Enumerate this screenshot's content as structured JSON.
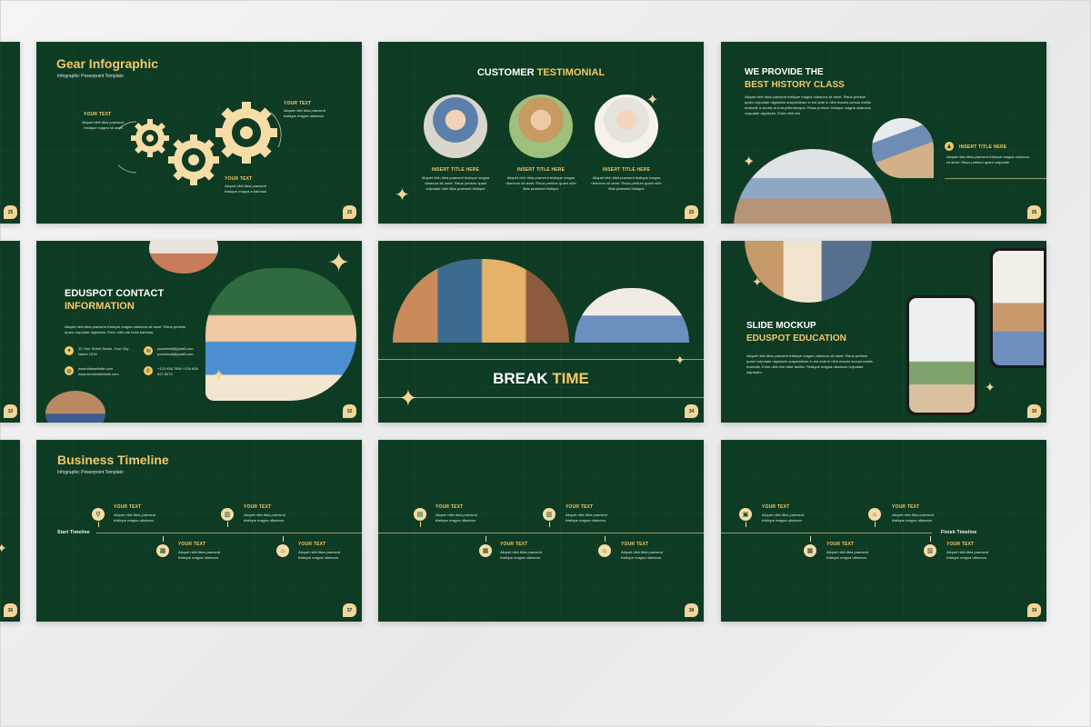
{
  "colors": {
    "slide_bg": "#0e3b23",
    "accent": "#f3c96b",
    "cream": "#f6dca6",
    "page_bg": "#eeeeee"
  },
  "gear": {
    "title": "Gear Infographic",
    "subtitle": "Infographic Powerpoint Template",
    "text_left_label": "YOUR TEXT",
    "text_left_body": "Aliquet nibh tibia praesent tristique magna sit amet.",
    "text_top_label": "YOUR TEXT",
    "text_top_body": "Aliquet nibh tibia praesent tristique magna ullamcos",
    "text_bottom_label": "YOUR TEXT",
    "text_bottom_body": "Aliquet nibh tibia praesent tristique magna a batrinas",
    "page": "25"
  },
  "testimonial": {
    "title_a": "CUSTOMER",
    "title_b": "TESTIMONIAL",
    "items": [
      {
        "label": "INSERT TITLE HERE",
        "body": "Aliquet nibh tibia praesent tristique magna ullamcos sit amet. Risus pretium quam vulputate nibh tibia praesent tristique"
      },
      {
        "label": "INSERT TITLE HERE",
        "body": "Aliquet nibh tibia praesent tristique magna ullamcos sit amet. Risus pretium quam nibh tibia praesent tristique"
      },
      {
        "label": "INSERT TITLE HERE",
        "body": "Aliquet nibh tibia praesent tristique magna ullamcos sit amet. Risus pretium quam nibh tibia praesent tristique"
      }
    ],
    "page": "25"
  },
  "history": {
    "title_a": "WE PROVIDE THE",
    "title_b": "BEST HISTORY CLASS",
    "body": "Aliquet nibh tibia praesent tristique magna ullamcos sit amet. Risus pretium quam vulputate dignissim suspendisse in est ante in nibh mauris cursus mattis molestie a iaculis at erat pellentesque. Risus pretium tristique magna ullamcos vulputate dignissim. Enim nibh nisl",
    "insert_label": "INSERT TITLE HERE",
    "insert_body": "Aliquet nibh tibia praesent tristique magna ullamcos sit amet. Risus pretium quam vulputate",
    "page": "26"
  },
  "contact": {
    "title_a": "EDUSPOT CONTACT",
    "title_b": "INFORMATION",
    "body": "Aliquet nibh tibia praesent tristique magna ullamcos sit amet. Risus pretium quam vulputate dignissim. Enim nibh nisl tenis batrinas.",
    "address": "12 Your Street Name, Your City Name 1234",
    "email": "youremail@gmail.com youremail@gmail.com",
    "website": "www.thiswebsite.com www.secondwebsite.com",
    "phone": "+123 456 7890 +234 608 827 8270",
    "page": "32"
  },
  "breaktime": {
    "title_a": "BREAK",
    "title_b": "TIME",
    "page": "34"
  },
  "mockup": {
    "title_a": "SLIDE MOCKUP",
    "title_b": "EDUSPOT EDUCATION",
    "body": "Aliquet nibh tibia praesent tristique magna ullamcos sit amet. Risus pretium quam vulputate dignissim suspendisse in est ante in nibh mauris cursus mattis molestie. Enim nibh nisl vitae facilisi. Tristique magna ullamcos vulputate dignissim.",
    "page": "35"
  },
  "timeline1": {
    "title": "Business Timeline",
    "subtitle": "Infographic Powerpoint Template",
    "start_label": "Start Timeline",
    "label": "YOUR TEXT",
    "body": "Aliquet nibh tibia praesent tristique magna ullamcos",
    "page": "37"
  },
  "timeline2": {
    "label": "YOUR TEXT",
    "body": "Aliquet nibh tibia praesent tristique magna ullamcos",
    "page": "38"
  },
  "timeline3": {
    "label": "YOUR TEXT",
    "body": "Aliquet nibh tibia praesent tristique magna ullamcos",
    "finish_label": "Finish Timeline",
    "page": "39"
  },
  "edge_pages": {
    "row1": "25",
    "row2": "32",
    "row3": "36"
  }
}
